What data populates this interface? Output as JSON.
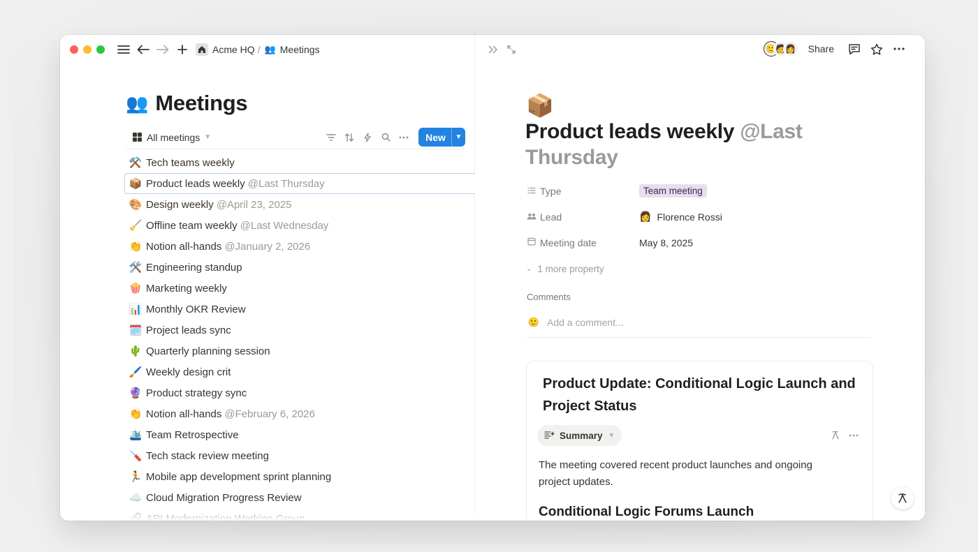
{
  "breadcrumb": {
    "workspace": "Acme HQ",
    "separator": "/",
    "page_emoji": "👥",
    "page": "Meetings"
  },
  "left": {
    "title_emoji": "👥",
    "title": "Meetings",
    "view_tab": "All meetings",
    "new_button": "New",
    "rows": [
      {
        "emoji": "⚒️",
        "name": "Tech teams weekly",
        "mention": ""
      },
      {
        "emoji": "📦",
        "name": "Product leads weekly",
        "mention": "@Last Thursday"
      },
      {
        "emoji": "🎨",
        "name": "Design weekly",
        "mention": "@April 23, 2025"
      },
      {
        "emoji": "🧹",
        "name": "Offline team weekly",
        "mention": "@Last Wednesday"
      },
      {
        "emoji": "👏",
        "name": "Notion all-hands",
        "mention": "@January 2, 2026"
      },
      {
        "emoji": "🛠️",
        "name": "Engineering standup",
        "mention": ""
      },
      {
        "emoji": "🍿",
        "name": "Marketing weekly",
        "mention": ""
      },
      {
        "emoji": "📊",
        "name": "Monthly OKR Review",
        "mention": ""
      },
      {
        "emoji": "🗓️",
        "name": "Project leads sync",
        "mention": ""
      },
      {
        "emoji": "🌵",
        "name": "Quarterly planning session",
        "mention": ""
      },
      {
        "emoji": "🖌️",
        "name": "Weekly design crit",
        "mention": ""
      },
      {
        "emoji": "🔮",
        "name": "Product strategy sync",
        "mention": ""
      },
      {
        "emoji": "👏",
        "name": "Notion all-hands",
        "mention": "@February 6, 2026"
      },
      {
        "emoji": "🛳️",
        "name": "Team Retrospective",
        "mention": ""
      },
      {
        "emoji": "🪛",
        "name": "Tech stack review meeting",
        "mention": ""
      },
      {
        "emoji": "🏃",
        "name": "Mobile app development sprint planning",
        "mention": ""
      },
      {
        "emoji": "☁️",
        "name": "Cloud Migration Progress Review",
        "mention": ""
      },
      {
        "emoji": "🔗",
        "name": "API Modernization Working Group",
        "mention": ""
      }
    ]
  },
  "right": {
    "share": "Share",
    "doc_emoji": "📦",
    "title": "Product leads weekly",
    "title_mention": "@Last Thursday",
    "properties": [
      {
        "icon": "list-icon",
        "name": "Type",
        "value": "Team meeting",
        "kind": "tag"
      },
      {
        "icon": "people-icon",
        "name": "Lead",
        "value": "Florence Rossi",
        "kind": "person"
      },
      {
        "icon": "calendar-icon",
        "name": "Meeting date",
        "value": "May 8, 2025",
        "kind": "text"
      }
    ],
    "more_properties": "1 more property",
    "comments_label": "Comments",
    "comment_placeholder": "Add a comment...",
    "card": {
      "title": "Product Update: Conditional Logic Launch and Project Status",
      "summary_label": "Summary",
      "body": "The meeting covered recent product launches and ongoing project updates.",
      "heading": "Conditional Logic Forums Launch"
    }
  },
  "colors": {
    "accent": "#2383e2",
    "tag_bg": "#e8deee",
    "tag_text": "#412454",
    "mention": "#9b9a97"
  }
}
